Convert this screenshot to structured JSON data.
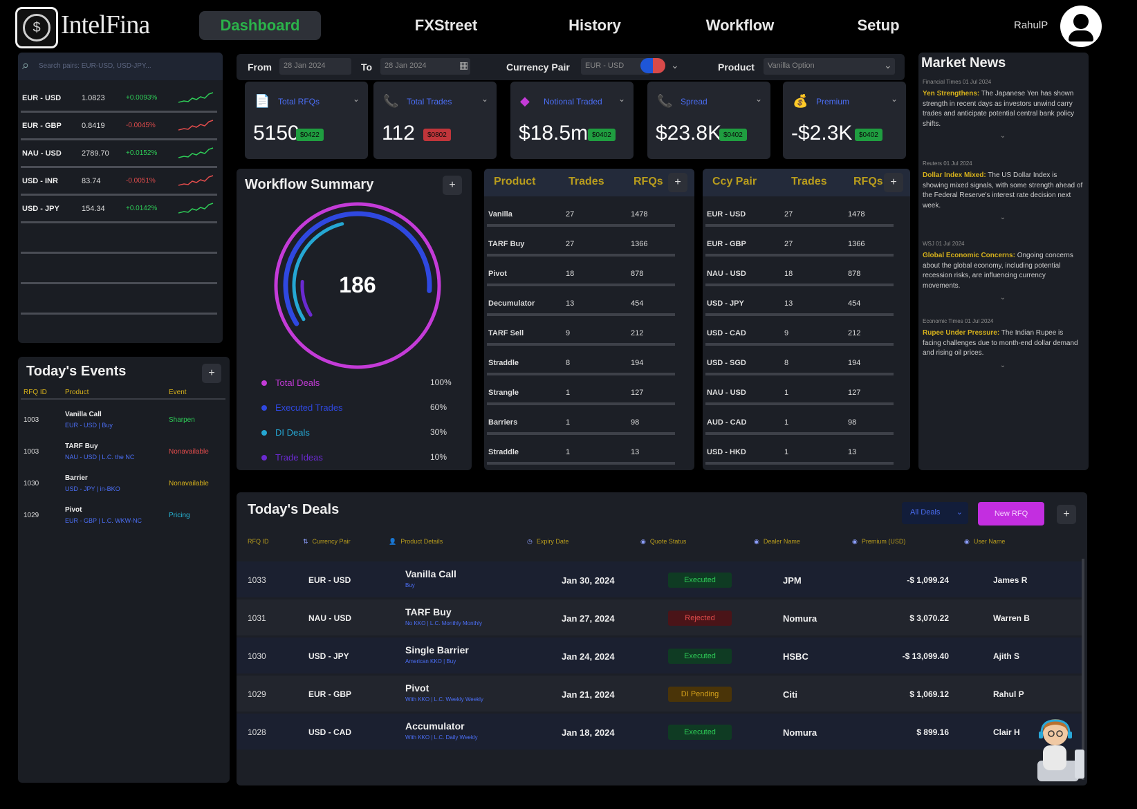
{
  "nav": {
    "brand": "IntelFina",
    "items": [
      "Dashboard",
      "FXStreet",
      "History",
      "Workflow",
      "Setup"
    ],
    "user": "RahulP"
  },
  "watchlist": {
    "search_placeholder": "Search pairs: EUR-USD, USD-JPY...",
    "rows": [
      {
        "pair": "EUR - USD",
        "price": "1.0823",
        "change": "+0.0093%",
        "dir": "up"
      },
      {
        "pair": "EUR - GBP",
        "price": "0.8419",
        "change": "-0.0045%",
        "dir": "down"
      },
      {
        "pair": "NAU - USD",
        "price": "2789.70",
        "change": "+0.0152%",
        "dir": "up"
      },
      {
        "pair": "USD - INR",
        "price": "83.74",
        "change": "-0.0051%",
        "dir": "down"
      },
      {
        "pair": "USD - JPY",
        "price": "154.34",
        "change": "+0.0142%",
        "dir": "up"
      }
    ]
  },
  "events": {
    "title": "Today's Events",
    "columns": [
      "RFQ ID",
      "Product",
      "Event"
    ],
    "rows": [
      {
        "id": "1003",
        "product": "Vanilla Call",
        "detail": "EUR - USD | Buy",
        "event": "Sharpen",
        "color": "#2ecc57"
      },
      {
        "id": "1003",
        "product": "TARF Buy",
        "detail": "NAU - USD | L.C. the NC",
        "event": "Nonavailable",
        "color": "#e24c4c"
      },
      {
        "id": "1030",
        "product": "Barrier",
        "detail": "USD - JPY | in-BKO",
        "event": "Nonavailable",
        "color": "#d6b11c"
      },
      {
        "id": "1029",
        "product": "Pivot",
        "detail": "EUR - GBP | L.C. WKW-NC",
        "event": "Pricing",
        "color": "#27b6d6"
      }
    ]
  },
  "filters": {
    "from_label": "From",
    "from_value": "28 Jan 2024",
    "to_label": "To",
    "to_value": "28 Jan 2024",
    "pair_label": "Currency Pair",
    "pair_value": "EUR - USD",
    "product_label": "Product",
    "product_value": "Vanilla Option"
  },
  "kpis": [
    {
      "label": "Total RFQs",
      "value": "5150",
      "badge": "$0422",
      "tone": "g",
      "icon": "📄"
    },
    {
      "label": "Total Trades",
      "value": "112",
      "badge": "$0802",
      "tone": "r",
      "icon": "📞"
    },
    {
      "label": "Notional Traded",
      "value": "$18.5m",
      "badge": "$0402",
      "tone": "g",
      "icon": "◆"
    },
    {
      "label": "Spread",
      "value": "$23.8K",
      "badge": "$0402",
      "tone": "g",
      "icon": "📞"
    },
    {
      "label": "Premium",
      "value": "-$2.3K",
      "badge": "$0402",
      "tone": "g",
      "icon": "💰"
    }
  ],
  "workflow": {
    "title": "Workflow Summary",
    "total": "186",
    "legend": [
      {
        "label": "Total Deals",
        "value": "100%",
        "color": "#c43bd8",
        "frac": 1.0
      },
      {
        "label": "Executed Trades",
        "value": "60%",
        "color": "#2f48e0",
        "frac": 0.6
      },
      {
        "label": "DI Deals",
        "value": "30%",
        "color": "#25a7d3",
        "frac": 0.3
      },
      {
        "label": "Trade Ideas",
        "value": "10%",
        "color": "#6a2ad0",
        "frac": 0.1
      }
    ]
  },
  "product_table": {
    "columns": [
      "Product",
      "Trades",
      "RFQs"
    ],
    "rows": [
      [
        "Vanilla",
        "27",
        "1478"
      ],
      [
        "TARF Buy",
        "27",
        "1366"
      ],
      [
        "Pivot",
        "18",
        "878"
      ],
      [
        "Decumulator",
        "13",
        "454"
      ],
      [
        "TARF Sell",
        "9",
        "212"
      ],
      [
        "Straddle",
        "8",
        "194"
      ],
      [
        "Strangle",
        "1",
        "127"
      ],
      [
        "Barriers",
        "1",
        "98"
      ],
      [
        "Straddle",
        "1",
        "13"
      ]
    ]
  },
  "pair_table": {
    "columns": [
      "Ccy Pair",
      "Trades",
      "RFQs"
    ],
    "rows": [
      [
        "EUR - USD",
        "27",
        "1478"
      ],
      [
        "EUR - GBP",
        "27",
        "1366"
      ],
      [
        "NAU - USD",
        "18",
        "878"
      ],
      [
        "USD - JPY",
        "13",
        "454"
      ],
      [
        "USD - CAD",
        "9",
        "212"
      ],
      [
        "USD - SGD",
        "8",
        "194"
      ],
      [
        "NAU - USD",
        "1",
        "127"
      ],
      [
        "AUD - CAD",
        "1",
        "98"
      ],
      [
        "USD - HKD",
        "1",
        "13"
      ]
    ]
  },
  "news": {
    "title": "Market News",
    "items": [
      {
        "source": "Financial Times",
        "date": "01 Jul 2024",
        "headline": "Yen Strengthens:",
        "body": "The Japanese Yen has shown strength in recent days as investors unwind carry trades and anticipate potential central bank policy shifts."
      },
      {
        "source": "Reuters",
        "date": "01 Jul 2024",
        "headline": "Dollar Index Mixed:",
        "body": "The US Dollar Index is showing mixed signals, with some strength ahead of the Federal Reserve's interest rate decision next week."
      },
      {
        "source": "WSJ",
        "date": "01 Jul 2024",
        "headline": "Global Economic Concerns:",
        "body": "Ongoing concerns about the global economy, including potential recession risks, are influencing currency movements."
      },
      {
        "source": "Economic Times",
        "date": "01 Jul 2024",
        "headline": "Rupee Under Pressure:",
        "body": "The Indian Rupee is facing challenges due to month-end dollar demand and rising oil prices."
      }
    ]
  },
  "deals": {
    "title": "Today's Deals",
    "filter_label": "All Deals",
    "new_button": "New RFQ",
    "columns": [
      "RFQ ID",
      "Currency Pair",
      "Product Details",
      "Expiry Date",
      "Quote Status",
      "Dealer Name",
      "Premium (USD)",
      "User Name"
    ],
    "rows": [
      {
        "id": "1033",
        "pair": "EUR - USD",
        "product": "Vanilla Call",
        "sub": "Buy",
        "expiry": "Jan 30, 2024",
        "status": "Executed",
        "status_tone": "exec",
        "dealer": "JPM",
        "premium": "-$ 1,099.24",
        "user": "James R"
      },
      {
        "id": "1031",
        "pair": "NAU - USD",
        "product": "TARF Buy",
        "sub": "No KKO | L.C. Monthly Monthly",
        "expiry": "Jan 27, 2024",
        "status": "Rejected",
        "status_tone": "rej",
        "dealer": "Nomura",
        "premium": "$ 3,070.22",
        "user": "Warren B"
      },
      {
        "id": "1030",
        "pair": "USD - JPY",
        "product": "Single Barrier",
        "sub": "American KKO | Buy",
        "expiry": "Jan 24, 2024",
        "status": "Executed",
        "status_tone": "exec",
        "dealer": "HSBC",
        "premium": "-$ 13,099.40",
        "user": "Ajith S"
      },
      {
        "id": "1029",
        "pair": "EUR - GBP",
        "product": "Pivot",
        "sub": "With KKO | L.C. Weekly Weekly",
        "expiry": "Jan 21, 2024",
        "status": "DI Pending",
        "status_tone": "pend",
        "dealer": "Citi",
        "premium": "$ 1,069.12",
        "user": "Rahul P"
      },
      {
        "id": "1028",
        "pair": "USD - CAD",
        "product": "Accumulator",
        "sub": "With KKO | L.C. Daily Weekly",
        "expiry": "Jan 18, 2024",
        "status": "Executed",
        "status_tone": "exec",
        "dealer": "Nomura",
        "premium": "$ 899.16",
        "user": "Clair H"
      }
    ]
  }
}
